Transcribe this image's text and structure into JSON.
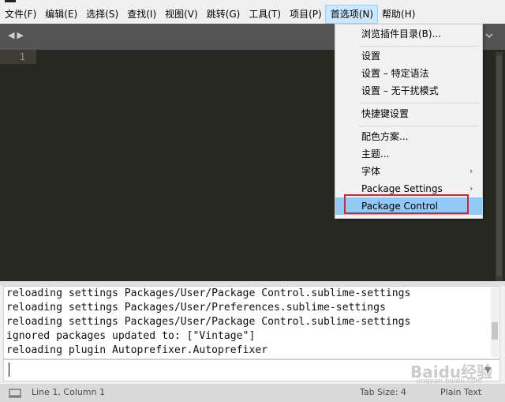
{
  "menubar": {
    "items": [
      "文件(F)",
      "编辑(E)",
      "选择(S)",
      "查找(I)",
      "视图(V)",
      "跳转(G)",
      "工具(T)",
      "项目(P)",
      "首选项(N)",
      "帮助(H)"
    ],
    "active_index": 8
  },
  "editor": {
    "line_number": "1"
  },
  "dropdown": {
    "items": [
      {
        "label": "浏览插件目录(B)...",
        "submenu": false
      },
      {
        "label": "设置",
        "submenu": false
      },
      {
        "label": "设置 – 特定语法",
        "submenu": false
      },
      {
        "label": "设置 – 无干扰模式",
        "submenu": false
      },
      {
        "label": "快捷键设置",
        "submenu": false
      },
      {
        "label": "配色方案...",
        "submenu": false
      },
      {
        "label": "主题...",
        "submenu": false
      },
      {
        "label": "字体",
        "submenu": true
      },
      {
        "label": "Package Settings",
        "submenu": true
      },
      {
        "label": "Package Control",
        "submenu": false,
        "highlighted": true
      }
    ]
  },
  "console": {
    "lines": [
      "reloading settings Packages/User/Package Control.sublime-settings",
      "reloading settings Packages/User/Preferences.sublime-settings",
      "reloading settings Packages/User/Package Control.sublime-settings",
      "ignored packages updated to: [\"Vintage\"]",
      "reloading plugin Autoprefixer.Autoprefixer"
    ],
    "input_value": ""
  },
  "statusbar": {
    "position": "Line 1, Column 1",
    "tab_size": "Tab Size: 4",
    "syntax": "Plain Text"
  },
  "watermark": {
    "text": "Baidu经验",
    "url": "jingyan.baidu.com"
  },
  "colors": {
    "highlight": "#91c9f7",
    "annotation_box": "#e0202a",
    "editor_bg": "#272822"
  }
}
